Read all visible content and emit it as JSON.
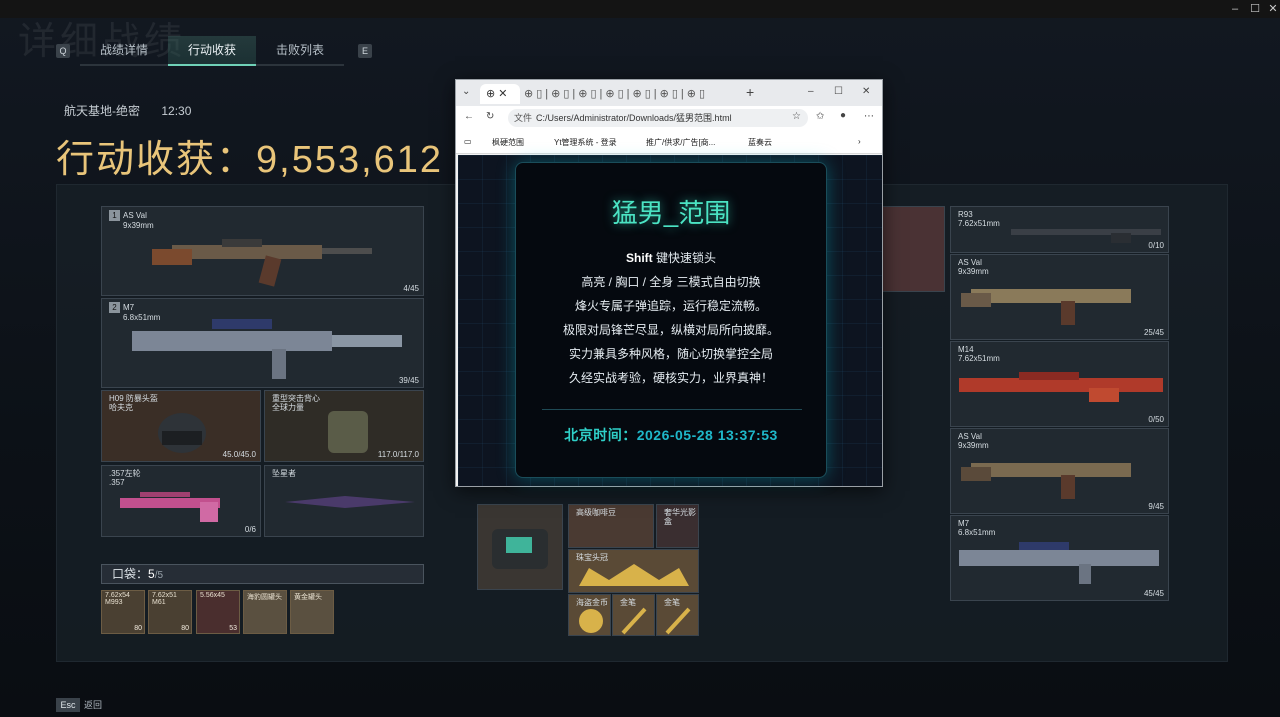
{
  "window": {
    "minimize": "–",
    "maximize": "☐",
    "close": "✕"
  },
  "bg_title": "详细战绩",
  "tabs": {
    "left_key": "Q",
    "right_key": "E",
    "items": [
      {
        "label": "战绩详情"
      },
      {
        "label": "行动收获"
      },
      {
        "label": "击败列表"
      }
    ]
  },
  "map": {
    "name": "航天基地-绝密",
    "time": "12:30"
  },
  "harvest": {
    "label": "行动收获：",
    "value": "9,553,612"
  },
  "left_slots": [
    {
      "index": "1",
      "name": "AS Val",
      "caliber": "9x39mm",
      "count": "4/45"
    },
    {
      "index": "2",
      "name": "M7",
      "caliber": "6.8x51mm",
      "count": "39/45"
    },
    {
      "name": "H09 防暴头盔",
      "sub": "哈夫克",
      "count": "45.0/45.0"
    },
    {
      "name": "重型突击背心",
      "sub": "全球力量",
      "count": "117.0/117.0"
    },
    {
      "name": ".357左轮",
      "sub": ".357",
      "count": "0/6"
    },
    {
      "name": "坠星者",
      "sub": "",
      "count": ""
    }
  ],
  "pocket": {
    "label": "口袋：",
    "current": "5",
    "max": "/5"
  },
  "ammo": [
    {
      "name": "7.62x54",
      "sub": "M993",
      "count": "80"
    },
    {
      "name": "7.62x51",
      "sub": "M61",
      "count": "80"
    },
    {
      "name": "5.56x45",
      "sub": "",
      "count": "53"
    },
    {
      "name": "海豹圆罐头",
      "sub": "",
      "count": ""
    },
    {
      "name": "黄金罐头",
      "sub": "",
      "count": ""
    }
  ],
  "mid_items": [
    {
      "name": "高级咖啡豆"
    },
    {
      "name": "奢华光影盒"
    },
    {
      "name": "珠宝头冠"
    },
    {
      "name": "海盗金币"
    },
    {
      "name": "金笔"
    },
    {
      "name": "金笔"
    }
  ],
  "right_slots": [
    {
      "name": "R93",
      "caliber": "7.62x51mm",
      "count": "0/10"
    },
    {
      "name": "AS Val",
      "caliber": "9x39mm",
      "count": "25/45"
    },
    {
      "name": "M14",
      "caliber": "7.62x51mm",
      "count": "0/50"
    },
    {
      "name": "AS Val",
      "caliber": "9x39mm",
      "count": "9/45"
    },
    {
      "name": "M7",
      "caliber": "6.8x51mm",
      "count": "45/45"
    }
  ],
  "bottom": {
    "key": "Esc",
    "label": "返回"
  },
  "browser": {
    "new_tab": "+",
    "address": "C:/Users/Administrator/Downloads/猛男范围.html",
    "address_prefix": "文件",
    "bookmarks": [
      "枫硬范围",
      "Yt管理系统 - 登录",
      "推广/供求/广告[商...",
      "蓝奏云"
    ],
    "card": {
      "title": "猛男_范围",
      "lines": [
        {
          "bold": "Shift",
          "text": " 键快速锁头"
        },
        {
          "bold": "",
          "text": "高亮 / 胸口 / 全身 三模式自由切换"
        },
        {
          "bold": "",
          "text": "烽火专属子弹追踪，运行稳定流畅。"
        },
        {
          "bold": "",
          "text": "极限对局锋芒尽显，纵横对局所向披靡。"
        },
        {
          "bold": "",
          "text": "实力兼具多种风格，随心切换掌控全局"
        },
        {
          "bold": "",
          "text": "久经实战考验，硬核实力，业界真神！"
        }
      ],
      "time_label": "北京时间：",
      "time_value": "2026-05-28 13:37:53"
    }
  }
}
